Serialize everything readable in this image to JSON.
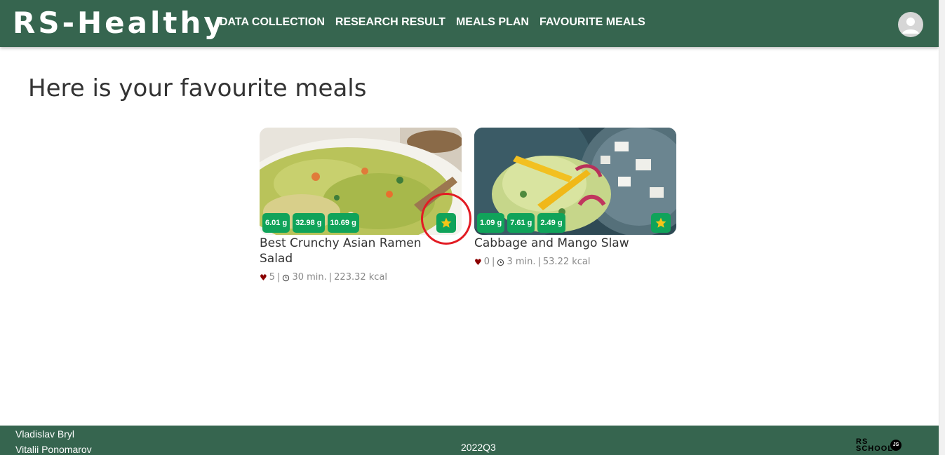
{
  "header": {
    "logo": "RS-Healthy",
    "nav": [
      {
        "label": "DATA COLLECTION"
      },
      {
        "label": "RESEARCH RESULT"
      },
      {
        "label": "MEALS PLAN"
      },
      {
        "label": "FAVOURITE MEALS"
      }
    ],
    "avatar_icon": "user-avatar-icon"
  },
  "main": {
    "title": "Here is your favourite meals",
    "meals": [
      {
        "name": "Best Crunchy Asian Ramen Salad",
        "nutrients": [
          "6.01 g",
          "32.98 g",
          "10.69 g"
        ],
        "likes": "5",
        "time": "30 min.",
        "calories": "223.32 kcal",
        "favourite_icon": "star-icon"
      },
      {
        "name": "Cabbage and Mango Slaw",
        "nutrients": [
          "1.09 g",
          "7.61 g",
          "2.49 g"
        ],
        "likes": "0",
        "time": "3 min.",
        "calories": "53.22 kcal",
        "favourite_icon": "star-icon"
      }
    ],
    "separator": "|"
  },
  "footer": {
    "authors": [
      "Vladislav Bryl",
      "Vitalii Ponomarov"
    ],
    "year": "2022Q3",
    "logo_text": "RS SCHOOL",
    "logo_badge": "JS"
  },
  "colors": {
    "header_bg": "#36654f",
    "badge_bg": "#10a35a",
    "star": "#f5c518",
    "heart": "#8b0000",
    "highlight": "#e21b23"
  }
}
